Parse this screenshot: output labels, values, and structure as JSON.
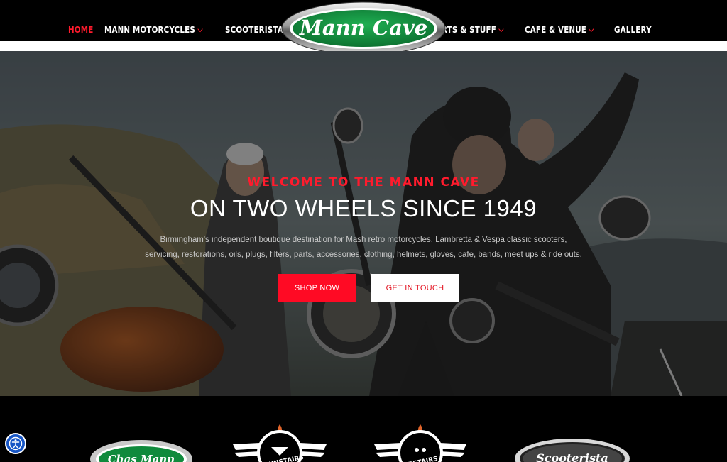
{
  "header": {
    "nav_left": [
      {
        "label": "HOME",
        "active": true,
        "dropdown": false
      },
      {
        "label": "MANN MOTORCYCLES",
        "active": false,
        "dropdown": true
      },
      {
        "label": "SCOOTERISTA",
        "active": false,
        "dropdown": true
      }
    ],
    "nav_right": [
      {
        "label": "PARTS & STUFF",
        "dropdown": true
      },
      {
        "label": "CAFE & VENUE",
        "dropdown": true
      },
      {
        "label": "GALLERY",
        "dropdown": false
      }
    ],
    "logo_text": "Mann Cave"
  },
  "hero": {
    "kicker": "WELCOME TO THE MANN CAVE",
    "title": "ON TWO WHEELS SINCE 1949",
    "subtitle": "Birmingham's independent boutique destination for Mash retro motorcycles, Lambretta & Vespa classic scooters, servicing, restorations, oils, plugs, filters, parts, accessories, clothing, helmets, gloves, cafe, bands, meet ups & ride outs.",
    "shop_label": "SHOP NOW",
    "touch_label": "GET IN TOUCH"
  },
  "brands": [
    {
      "name": "Chas Mann"
    },
    {
      "name": "DOWNSTAIRS"
    },
    {
      "name": "UPSTAIRS"
    },
    {
      "name": "Scooterista"
    }
  ],
  "colors": {
    "accent": "#ff1b2d",
    "logo_green": "#0f8a3c",
    "accessibility_blue": "#1756c6"
  },
  "icons": {
    "accessibility": "accessibility-icon",
    "dropdown": "chevron-down-icon"
  }
}
